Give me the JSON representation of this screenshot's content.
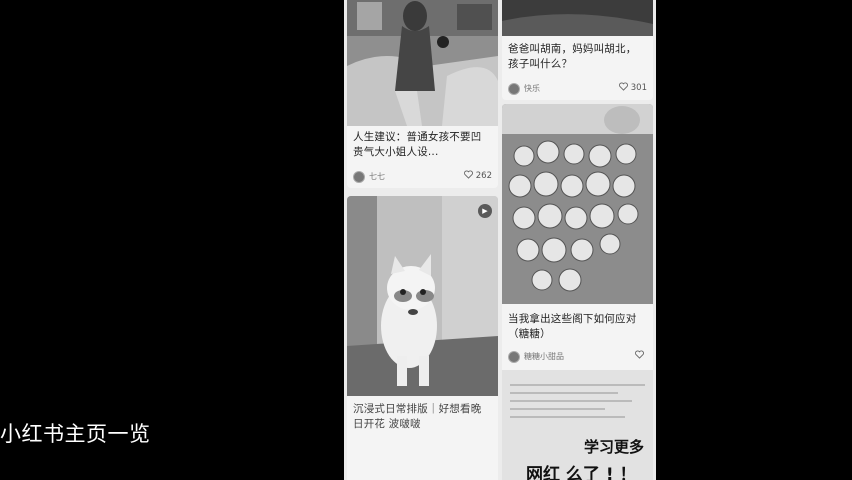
{
  "feed": {
    "left": [
      {
        "title": "人生建议：普通女孩不要凹贵气大小姐人设...",
        "author": "七七",
        "likes": "262"
      },
      {
        "title": "沉浸式日常排版｜好想看晚日开花 波啵啵",
        "author": "",
        "likes": ""
      }
    ],
    "right": [
      {
        "title": "爸爸叫胡南，妈妈叫胡北，孩子叫什么？",
        "author": "快乐",
        "likes": "301"
      },
      {
        "title": "当我拿出这些阁下如何应对（糖糖）",
        "author": "糖糖小甜品",
        "likes": ""
      }
    ]
  },
  "overlay": {
    "caption": "小红书主页一览",
    "promo_line1": "学习更多",
    "promo_line2": "网红 么了 ! ！"
  },
  "colors": {
    "background": "#000000",
    "feed_bg": "#ececec"
  }
}
